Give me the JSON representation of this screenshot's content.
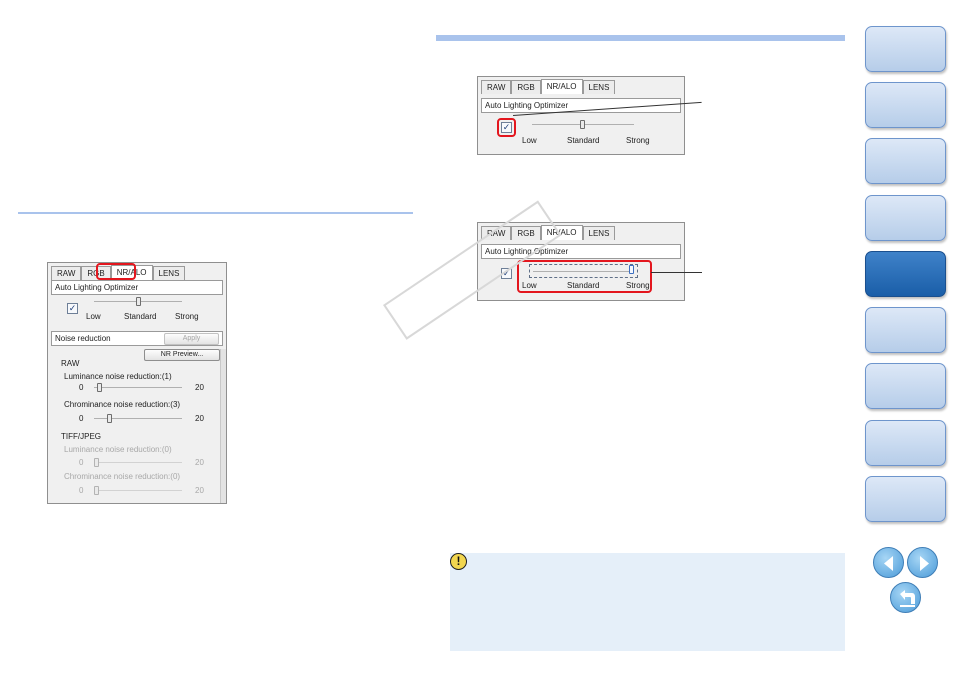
{
  "left_dialog": {
    "tabs": [
      "RAW",
      "RGB",
      "NR/ALO",
      "LENS"
    ],
    "alo_header": "Auto Lighting Optimizer",
    "alo_checkbox_mark": "✓",
    "alo_labels": [
      "Low",
      "Standard",
      "Strong"
    ],
    "nr_header": "Noise reduction",
    "apply_label": "Apply",
    "nr_preview_label": "NR Preview...",
    "raw_heading": "RAW",
    "raw_luminance": {
      "label": "Luminance noise reduction:(1)",
      "min": "0",
      "max": "20",
      "value": 1
    },
    "raw_chrominance": {
      "label": "Chrominance noise reduction:(3)",
      "min": "0",
      "max": "20",
      "value": 3
    },
    "tiff_heading": "TIFF/JPEG",
    "tiff_luminance": {
      "label": "Luminance noise reduction:(0)",
      "min": "0",
      "max": "20",
      "value": 0
    },
    "tiff_chrominance": {
      "label": "Chrominance noise reduction:(0)",
      "min": "0",
      "max": "20",
      "value": 0
    }
  },
  "right_dialog_1": {
    "tabs": [
      "RAW",
      "RGB",
      "NR/ALO",
      "LENS"
    ],
    "header": "Auto Lighting Optimizer",
    "checkbox_mark": "✓",
    "labels": [
      "Low",
      "Standard",
      "Strong"
    ]
  },
  "right_dialog_2": {
    "tabs": [
      "RAW",
      "RGB",
      "NR/ALO",
      "LENS"
    ],
    "header": "Auto Lighting Optimizer",
    "checkbox_mark": "✓",
    "labels": [
      "Low",
      "Standard",
      "Strong"
    ]
  },
  "note": {
    "icon": "!"
  },
  "colors": {
    "accent": "#a9c3ec",
    "highlight": "#e3161e",
    "nav_active": "#1a5ea8",
    "note_bg": "#e5eff9"
  }
}
